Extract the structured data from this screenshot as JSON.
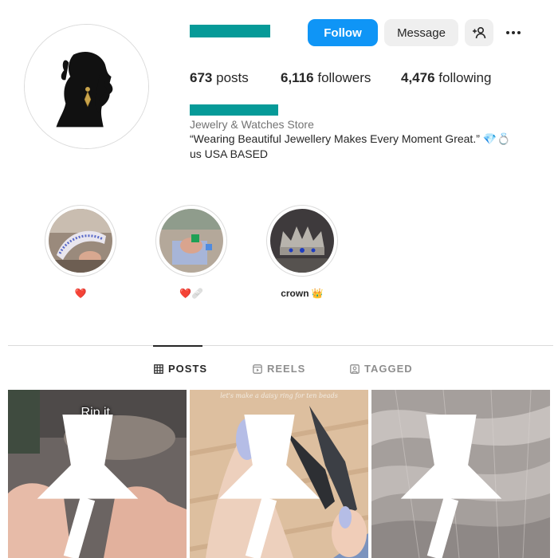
{
  "profile": {
    "follow_label": "Follow",
    "message_label": "Message",
    "stats": {
      "posts_count": "673",
      "posts_label": "posts",
      "followers_count": "6,116",
      "followers_label": "followers",
      "following_count": "4,476",
      "following_label": "following"
    },
    "bio": {
      "category": "Jewelry & Watches Store",
      "line1": "“Wearing Beautiful Jewellery Makes Every Moment Great.” 💎💍",
      "line2": "us USA BASED"
    }
  },
  "highlights": [
    {
      "label": "❤️"
    },
    {
      "label": "❤️🩹"
    },
    {
      "label": "crown 👑"
    }
  ],
  "tabs": [
    {
      "label": "POSTS",
      "active": true,
      "icon": "grid-icon"
    },
    {
      "label": "REELS",
      "active": false,
      "icon": "reels-icon"
    },
    {
      "label": "TAGGED",
      "active": false,
      "icon": "tagged-icon"
    }
  ],
  "posts": [
    {
      "caption": "Rip it.",
      "pinned": true
    },
    {
      "caption": "let's make a daisy ring for ten beads",
      "pinned": true
    },
    {
      "caption": "",
      "pinned": true
    }
  ],
  "colors": {
    "accent": "#0f95f6",
    "redaction": "#069a98"
  }
}
